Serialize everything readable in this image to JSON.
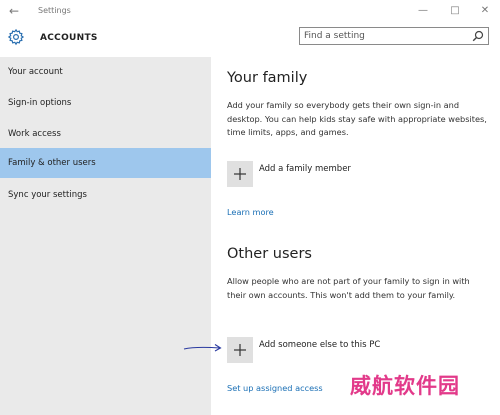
{
  "window": {
    "title": "Settings",
    "back_icon": "back-arrow-icon",
    "controls": [
      "minimize-icon",
      "maximize-icon",
      "close-icon"
    ]
  },
  "header": {
    "icon": "gear-icon",
    "title": "ACCOUNTS",
    "search_placeholder": "Find a setting",
    "search_value": ""
  },
  "sidebar": {
    "items": [
      {
        "label": "Your account",
        "active": false
      },
      {
        "label": "Sign-in options",
        "active": false
      },
      {
        "label": "Work access",
        "active": false
      },
      {
        "label": "Family & other users",
        "active": true
      },
      {
        "label": "Sync your settings",
        "active": false
      }
    ],
    "active_color": "#9ec7ed"
  },
  "main": {
    "family": {
      "heading": "Your family",
      "description": "Add your family so everybody gets their own sign-in and desktop. You can help kids stay safe with appropriate websites, time limits, apps, and games.",
      "add_label": "Add a family member",
      "link": "Learn more"
    },
    "others": {
      "heading": "Other users",
      "description": "Allow people who are not part of your family to sign in with their own accounts. This won't add them to your family.",
      "add_label": "Add someone else to this PC",
      "link": "Set up assigned access"
    }
  },
  "watermark": "威航软件园",
  "colors": {
    "link": "#1a6fb5",
    "sidebar_bg": "#eaeaea",
    "annotation_arrow": "#2a3aa0",
    "watermark": "#e23a8a"
  }
}
